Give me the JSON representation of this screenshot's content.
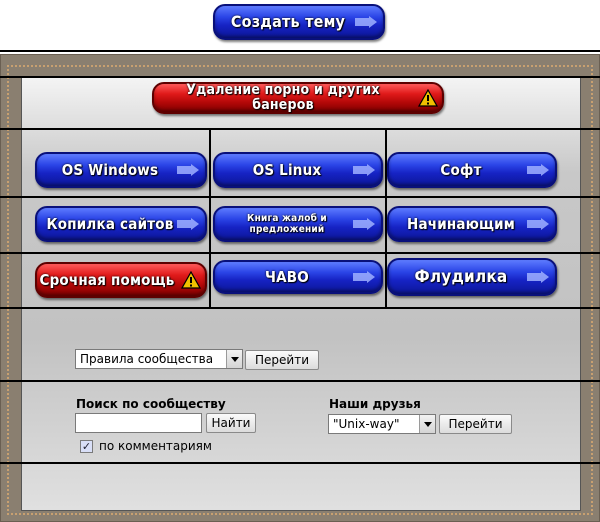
{
  "header": {
    "create_topic": "Создать тему"
  },
  "alert_banner": "Удаление порно и других банеров",
  "forums": {
    "windows": "OS Windows",
    "linux": "OS Linux",
    "soft": "Софт",
    "sites": "Копилка сайтов",
    "complaints": "Книга жалоб и предложений",
    "beginners": "Начинающим",
    "urgent": "Срочная помощь",
    "faq": "ЧАВО",
    "flood": "Флудилка"
  },
  "community": {
    "rules_select": "Правила сообщества",
    "go_label": "Перейти"
  },
  "search": {
    "label": "Поиск по сообществу",
    "value": "",
    "find_label": "Найти",
    "comments_label": "по комментариям",
    "comments_checked": true
  },
  "friends": {
    "label": "Наши друзья",
    "select": "\"Unix-way\"",
    "go_label": "Перейти"
  },
  "colors": {
    "blue": "#1623c4",
    "red": "#b50808",
    "frame": "#8a7f70"
  }
}
